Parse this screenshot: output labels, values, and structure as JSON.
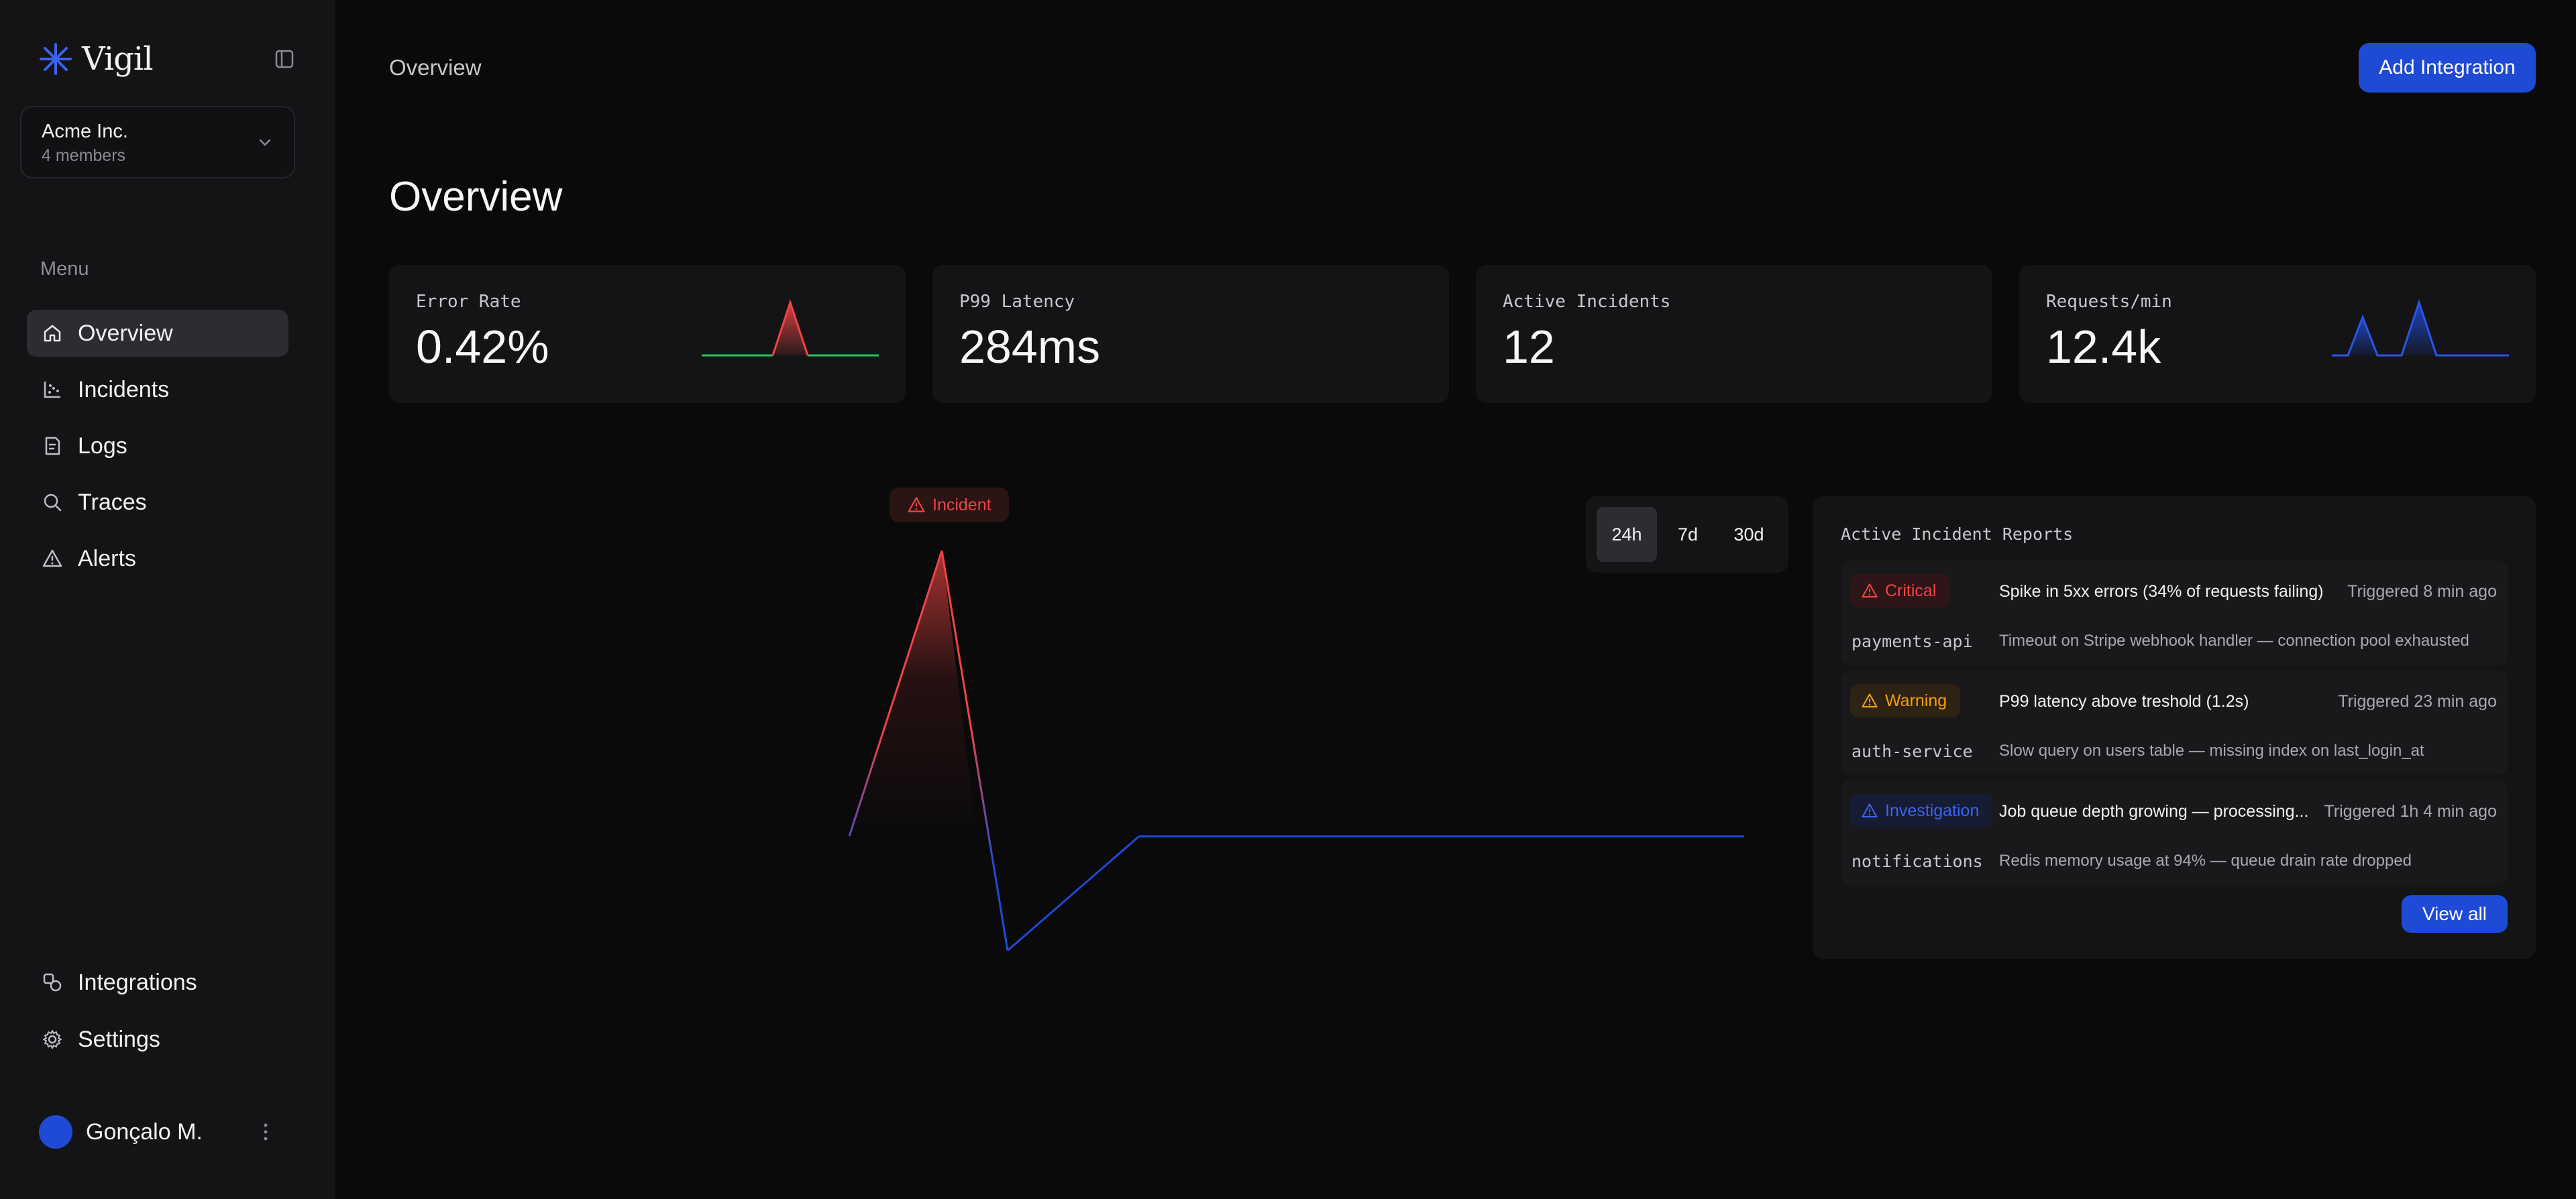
{
  "app": {
    "name": "Vigil"
  },
  "org": {
    "name": "Acme Inc.",
    "members": "4 members"
  },
  "sidebar": {
    "menu_label": "Menu",
    "items": [
      {
        "label": "Overview",
        "icon": "home-icon",
        "active": true
      },
      {
        "label": "Incidents",
        "icon": "scatter-chart-icon"
      },
      {
        "label": "Logs",
        "icon": "document-icon"
      },
      {
        "label": "Traces",
        "icon": "search-icon"
      },
      {
        "label": "Alerts",
        "icon": "warning-triangle-icon"
      }
    ],
    "bottom_items": [
      {
        "label": "Integrations",
        "icon": "integrations-icon"
      },
      {
        "label": "Settings",
        "icon": "gear-icon"
      }
    ]
  },
  "user": {
    "name": "Gonçalo M."
  },
  "header": {
    "breadcrumb": "Overview",
    "add_button": "Add Integration"
  },
  "page": {
    "title": "Overview"
  },
  "stats": [
    {
      "label": "Error Rate",
      "value": "0.42%"
    },
    {
      "label": "P99 Latency",
      "value": "284ms"
    },
    {
      "label": "Active Incidents",
      "value": "12"
    },
    {
      "label": "Requests/min",
      "value": "12.4k"
    }
  ],
  "chart": {
    "incident_label": "Incident",
    "ranges": [
      {
        "label": "24h",
        "selected": true
      },
      {
        "label": "7d"
      },
      {
        "label": "30d"
      }
    ]
  },
  "chart_data": {
    "type": "line",
    "x": [
      0,
      1,
      2,
      3,
      4,
      5,
      6
    ],
    "values": [
      0,
      0,
      0,
      1,
      -0.4,
      0,
      0
    ],
    "annotation": "Incident",
    "xlim": [
      0,
      6
    ],
    "ylim": [
      -0.5,
      1.05
    ],
    "colors": {
      "baseline": "#1f4ad6",
      "spike": "#ef4444"
    }
  },
  "reports": {
    "title": "Active Incident Reports",
    "items": [
      {
        "severity": "Critical",
        "title": "Spike in 5xx errors (34% of requests failing)",
        "time": "Triggered 8 min ago",
        "service": "payments-api",
        "description": "Timeout on Stripe webhook handler — connection pool exhausted"
      },
      {
        "severity": "Warning",
        "title": "P99 latency above treshold (1.2s)",
        "time": "Triggered 23 min ago",
        "service": "auth-service",
        "description": "Slow query on users table — missing index on last_login_at"
      },
      {
        "severity": "Investigation",
        "title": "Job queue depth growing — processing...",
        "time": "Triggered 1h 4 min ago",
        "service": "notifications",
        "description": "Redis memory usage at 94% — queue drain rate dropped"
      }
    ],
    "view_all": "View all"
  },
  "colors": {
    "accent": "#1f4ad6",
    "critical": "#ef4444",
    "warning": "#f59e0b",
    "success": "#22c55e",
    "investigation": "#3b63ef"
  }
}
